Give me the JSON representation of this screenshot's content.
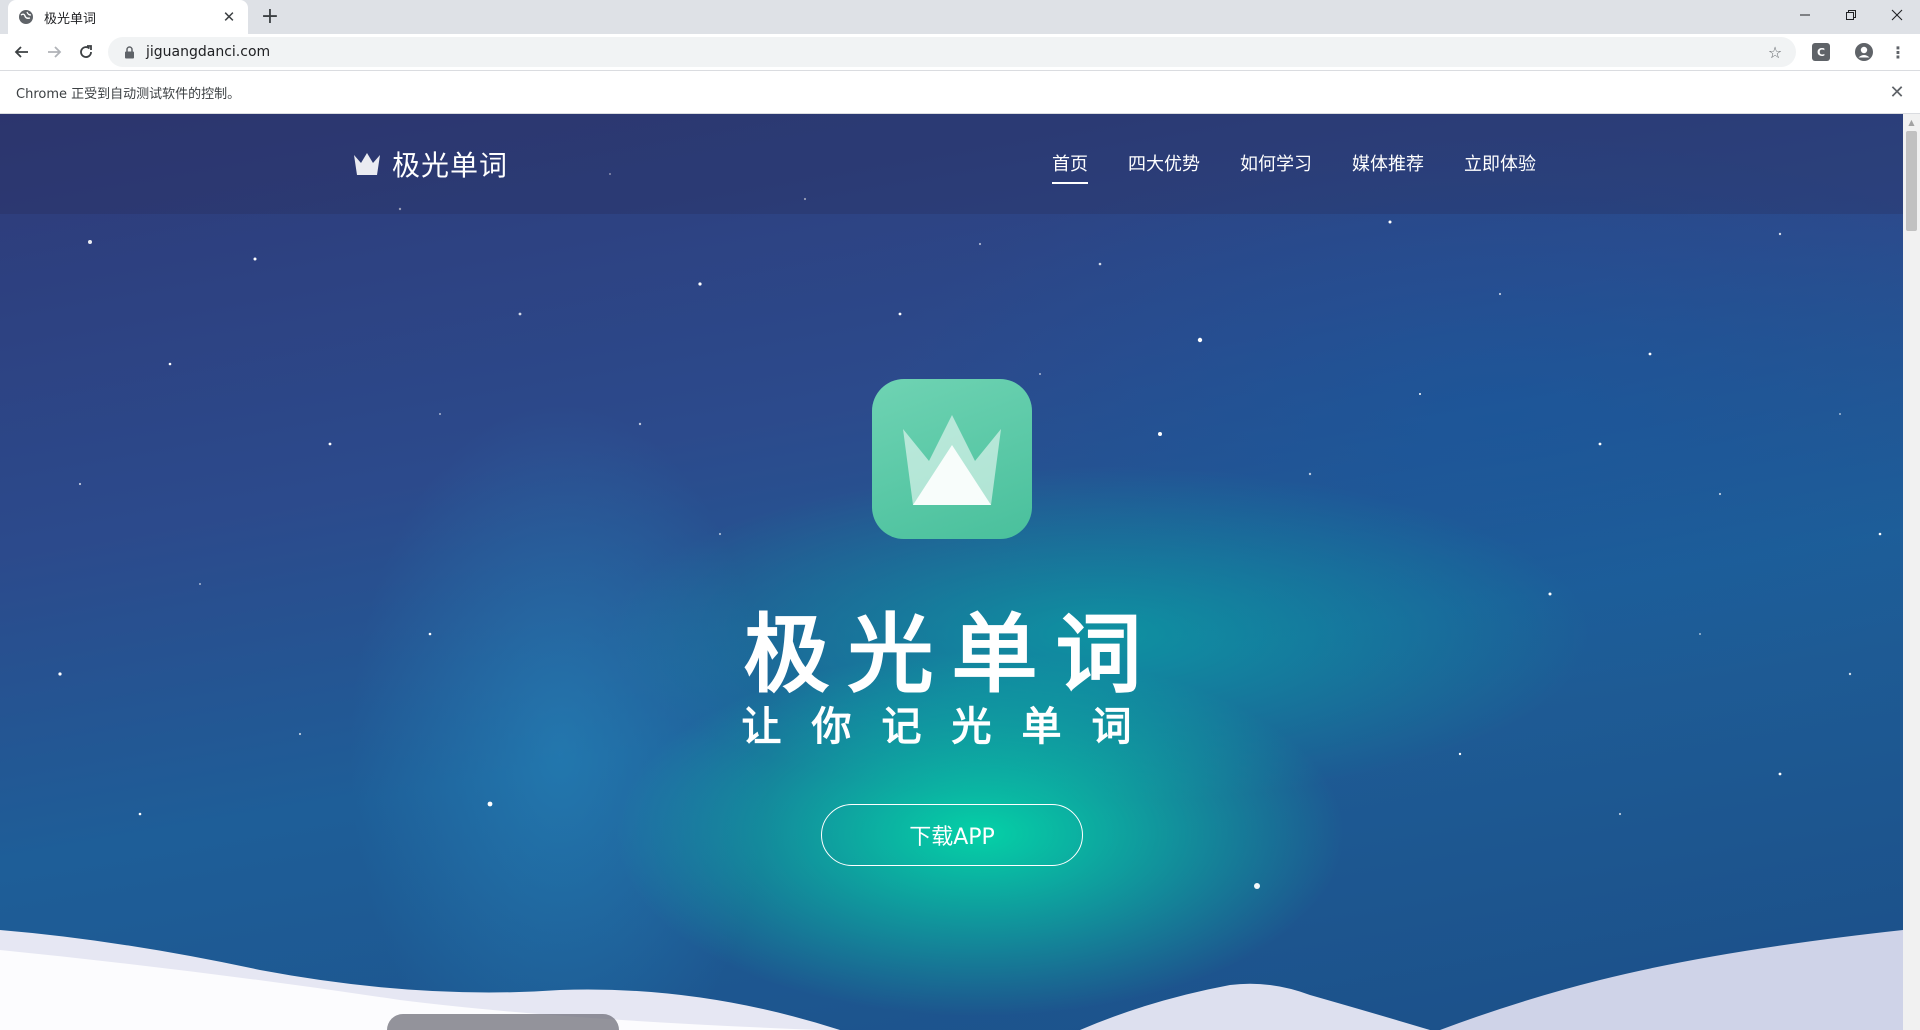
{
  "browser": {
    "tab_title": "极光单词",
    "url": "jiguangdanci.com",
    "infobar_text": "Chrome 正受到自动测试软件的控制。",
    "extension_label": "C"
  },
  "site": {
    "brand_name": "极光单词",
    "nav": [
      "首页",
      "四大优势",
      "如何学习",
      "媒体推荐",
      "立即体验"
    ],
    "active_nav": "首页",
    "hero_title": "极光单词",
    "hero_subtitle": "让你记光单词",
    "cta_label": "下载APP"
  },
  "colors": {
    "app_icon": "#5cc9a7",
    "aurora_green": "#00e0a8",
    "sky_top": "#2e3a78"
  }
}
